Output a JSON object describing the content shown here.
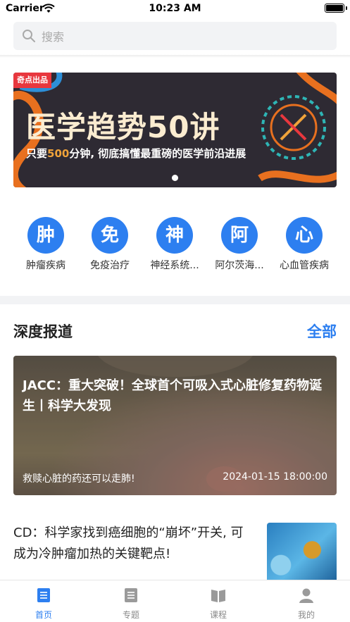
{
  "status_bar": {
    "carrier": "Carrier",
    "time": "10:23 AM"
  },
  "search": {
    "placeholder": "搜索"
  },
  "banner": {
    "badge": "奇点出品",
    "title": "医学趋势50讲",
    "subtitle_pre": "只要",
    "subtitle_highlight": "500",
    "subtitle_post": "分钟, 彻底搞懂最重磅的医学前沿进展",
    "page_indicator": "1"
  },
  "categories": [
    {
      "glyph": "肿",
      "label": "肿瘤疾病"
    },
    {
      "glyph": "免",
      "label": "免疫治疗"
    },
    {
      "glyph": "神",
      "label": "神经系统..."
    },
    {
      "glyph": "阿",
      "label": "阿尔茨海..."
    },
    {
      "glyph": "心",
      "label": "心血管疾病"
    }
  ],
  "section": {
    "title": "深度报道",
    "all_label": "全部"
  },
  "featured": {
    "title": "JACC：重大突破！全球首个可吸入式心脏修复药物诞生丨科学大发现",
    "caption": "救赎心脏的药还可以走肺!",
    "date": "2024-01-15 18:00:00"
  },
  "article": {
    "title": "CD：科学家找到癌细胞的“崩坏”开关, 可成为冷肿瘤加热的关键靶点!"
  },
  "tabs": [
    {
      "label": "首页",
      "icon": "home-icon",
      "active": true
    },
    {
      "label": "专题",
      "icon": "topics-icon",
      "active": false
    },
    {
      "label": "课程",
      "icon": "book-icon",
      "active": false
    },
    {
      "label": "我的",
      "icon": "profile-icon",
      "active": false
    }
  ],
  "colors": {
    "accent": "#2d7ff0",
    "banner_bg": "#2e2a33",
    "badge_red": "#e8373e"
  }
}
